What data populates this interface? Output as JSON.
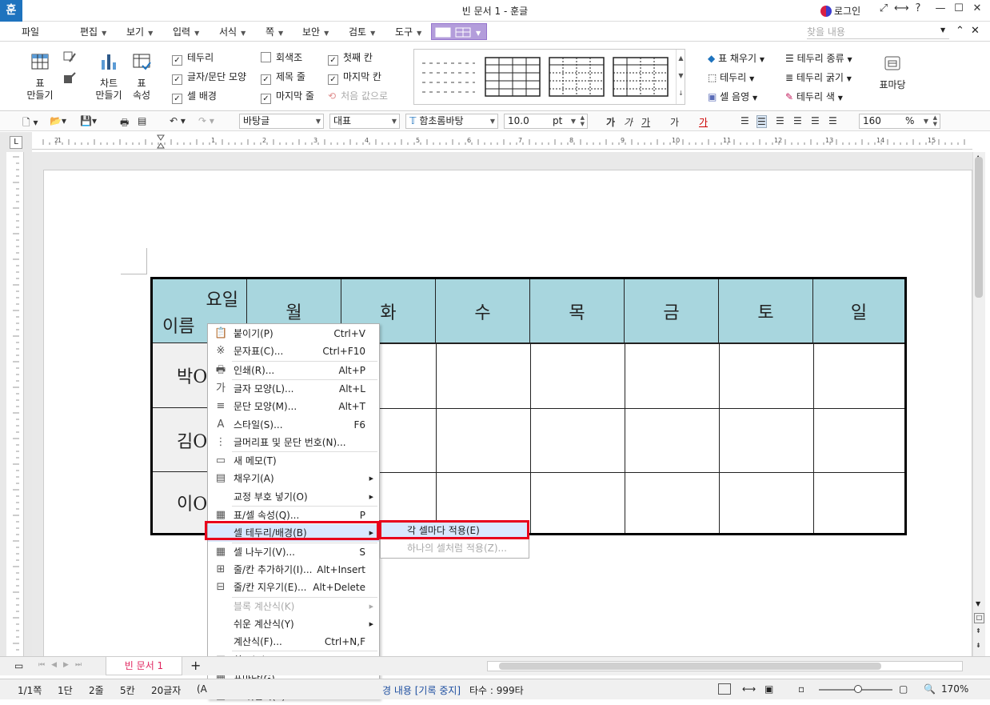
{
  "window": {
    "title": "빈 문서 1 - 훈글",
    "app_icon": "훈",
    "login": "로그인",
    "controls": [
      "⤢",
      "⟷",
      "?",
      "—",
      "☐",
      "✕"
    ]
  },
  "menubar": {
    "items": [
      "파일",
      "편집",
      "보기",
      "입력",
      "서식",
      "쪽",
      "보안",
      "검토",
      "도구"
    ],
    "search_placeholder": "찾을 내용"
  },
  "ribbon": {
    "make_table": "표\n만들기",
    "make_chart": "차트\n만들기",
    "table_props": "표\n속성",
    "checks": [
      {
        "label": "테두리",
        "checked": true
      },
      {
        "label": "글자/문단 모양",
        "checked": true
      },
      {
        "label": "셀 배경",
        "checked": true
      },
      {
        "label": "회색조",
        "checked": false
      },
      {
        "label": "제목 줄",
        "checked": true
      },
      {
        "label": "마지막 줄",
        "checked": true
      },
      {
        "label": "첫째 칸",
        "checked": true
      },
      {
        "label": "마지막 칸",
        "checked": true
      },
      {
        "label": "처음 값으로",
        "checked": false,
        "disabled": true
      }
    ],
    "right_col1": [
      "표 채우기",
      "테두리",
      "셀 음영"
    ],
    "right_col2": [
      "테두리 종류",
      "테두리 굵기",
      "테두리 색"
    ],
    "table_stamp": "표마당"
  },
  "toolbar": {
    "style": "바탕글",
    "lang": "대표",
    "font": "함초롬바탕",
    "size": "10.0",
    "size_unit": "pt",
    "zoom": "160",
    "zoom_unit": "%",
    "char_btns": [
      "가",
      "가",
      "가",
      "가",
      "가"
    ]
  },
  "ruler": {
    "h_labels": [
      "2",
      "1",
      "1",
      "2",
      "3",
      "4",
      "5",
      "6",
      "7",
      "8",
      "9",
      "10",
      "11",
      "12",
      "13",
      "14",
      "15"
    ]
  },
  "table": {
    "corner_top": "요일",
    "corner_bottom": "이름",
    "days": [
      "월",
      "화",
      "수",
      "목",
      "금",
      "토",
      "일"
    ],
    "names": [
      "박O",
      "김O",
      "이O"
    ]
  },
  "context_menu": {
    "items": [
      {
        "icon": "📋",
        "label": "붙이기(P)",
        "shortcut": "Ctrl+V"
      },
      {
        "icon": "※",
        "label": "문자표(C)...",
        "shortcut": "Ctrl+F10"
      },
      {
        "icon": "🖶",
        "label": "인쇄(R)...",
        "shortcut": "Alt+P"
      },
      {
        "icon": "가",
        "label": "글자 모양(L)...",
        "shortcut": "Alt+L"
      },
      {
        "icon": "≡",
        "label": "문단 모양(M)...",
        "shortcut": "Alt+T"
      },
      {
        "icon": "A",
        "label": "스타일(S)...",
        "shortcut": "F6"
      },
      {
        "icon": "⋮",
        "label": "글머리표 및 문단 번호(N)...",
        "shortcut": ""
      },
      {
        "icon": "▭",
        "label": "새 메모(T)",
        "shortcut": ""
      },
      {
        "icon": "▤",
        "label": "채우기(A)",
        "shortcut": "",
        "sub": true
      },
      {
        "icon": "",
        "label": "교정 부호 넣기(O)",
        "shortcut": "",
        "sub": true
      },
      {
        "icon": "▦",
        "label": "표/셀 속성(Q)...",
        "shortcut": "P"
      },
      {
        "icon": "",
        "label": "셀 테두리/배경(B)",
        "shortcut": "",
        "sub": true,
        "highlight": true
      },
      {
        "icon": "▦",
        "label": "셀 나누기(V)...",
        "shortcut": "S"
      },
      {
        "icon": "⊞",
        "label": "줄/칸 추가하기(I)...",
        "shortcut": "Alt+Insert"
      },
      {
        "icon": "⊟",
        "label": "줄/칸 지우기(E)...",
        "shortcut": "Alt+Delete"
      },
      {
        "icon": "",
        "label": "블록 계산식(K)",
        "shortcut": "",
        "sub": true,
        "disabled": true
      },
      {
        "icon": "",
        "label": "쉬운 계산식(Y)",
        "shortcut": "",
        "sub": true
      },
      {
        "icon": "",
        "label": "계산식(F)...",
        "shortcut": "Ctrl+N,F"
      },
      {
        "icon": "▥",
        "label": "차트(H)",
        "shortcut": "",
        "sub": true
      },
      {
        "icon": "▦",
        "label": "표마당(G)...",
        "shortcut": ""
      },
      {
        "icon": "▦",
        "label": "표 뒤집기(S)...",
        "shortcut": "T"
      }
    ],
    "submenu": [
      "각 셀마다 적용(E)",
      "하나의 셀처럼 적용(Z)..."
    ]
  },
  "tabbar": {
    "doc_tab": "빈 문서 1",
    "add": "+"
  },
  "status": {
    "page": "1/1쪽",
    "col": "1단",
    "line": "2줄",
    "cell": "5칸",
    "chars": "20글자",
    "extra": "(A",
    "track": "경 내용 [기록 중지]",
    "count": "타수 : 999타",
    "zoom": "170%"
  }
}
